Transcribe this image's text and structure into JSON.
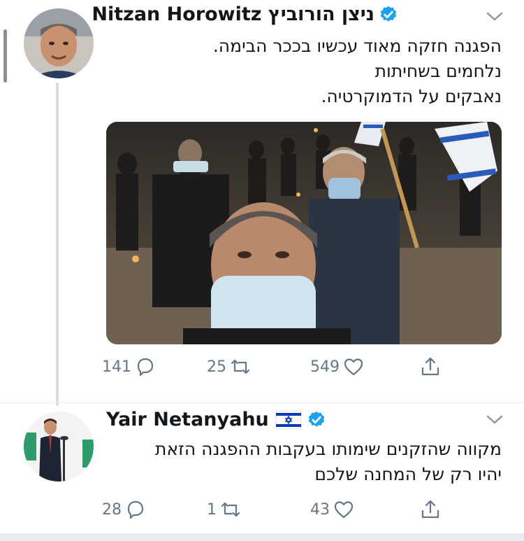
{
  "tweet1": {
    "author_name": "Nitzan Horowitz ניצן הורוביץ",
    "verified_icon": "verified-badge-icon",
    "text_lines": [
      "הפגנה חזקה מאוד עכשיו בככר הבימה.",
      "נלחמים בשחיתות",
      "נאבקים על הדמוקרטיה."
    ],
    "actions": {
      "replies": "141",
      "retweets": "25",
      "likes": "549"
    }
  },
  "tweet2": {
    "author_name": "Yair Netanyahu",
    "flag": "🇮🇱",
    "verified_icon": "verified-badge-icon",
    "text_lines": [
      "מקווה שהזקנים שימותו בעקבות ההפגנה הזאת",
      "יהיו רק של המחנה שלכם"
    ],
    "actions": {
      "replies": "28",
      "retweets": "1",
      "likes": "43"
    }
  },
  "colors": {
    "verified": "#1da1f2",
    "action_gray": "#657786",
    "divider": "#e6ecf0"
  }
}
